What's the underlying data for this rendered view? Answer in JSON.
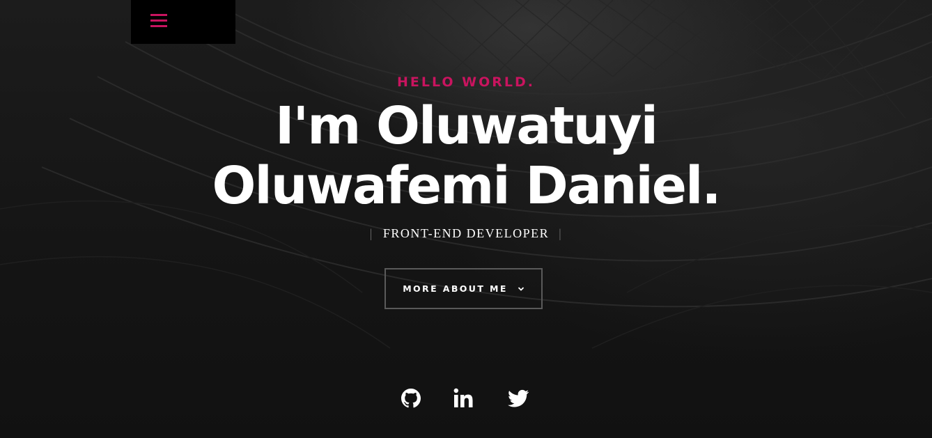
{
  "nav": {
    "menu_icon": "hamburger-icon",
    "accent_color": "#c9145f"
  },
  "hero": {
    "greeting": "HELLO WORLD.",
    "name_line1": "I'm Oluwatuyi",
    "name_line2": "Oluwafemi Daniel.",
    "role_separator": "|",
    "role": "FRONT-END DEVELOPER",
    "cta_label": "MORE ABOUT ME",
    "cta_icon": "chevron-down-icon"
  },
  "social": [
    {
      "name": "github",
      "icon": "github-icon"
    },
    {
      "name": "linkedin",
      "icon": "linkedin-icon"
    },
    {
      "name": "twitter",
      "icon": "twitter-icon"
    }
  ],
  "colors": {
    "background": "#121212",
    "accent": "#c9145f",
    "text": "#ffffff",
    "button_border": "#5a5a5a"
  }
}
